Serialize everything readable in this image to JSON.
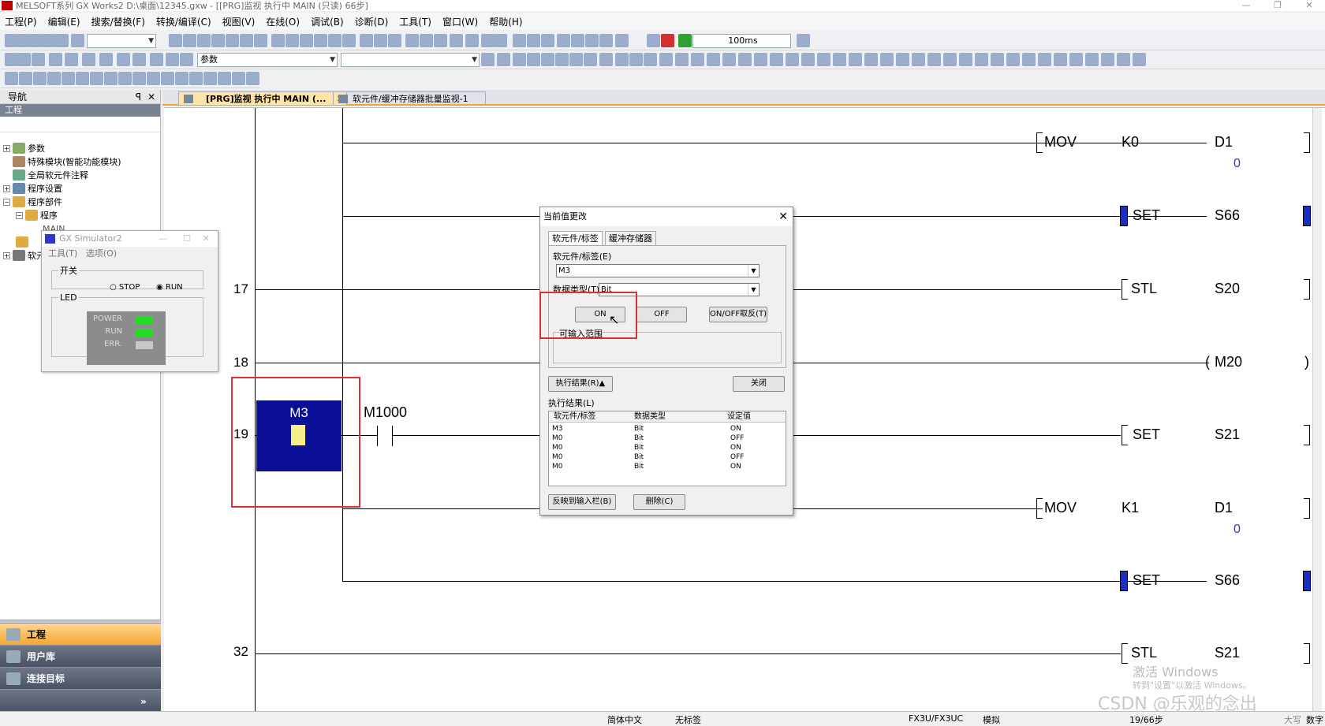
{
  "window": {
    "title": "MELSOFT系列 GX Works2 D:\\桌面\\12345.gxw - [[PRG]监视 执行中 MAIN (只读) 66步]"
  },
  "menu": [
    "工程(P)",
    "编辑(E)",
    "搜索/替换(F)",
    "转换/编译(C)",
    "视图(V)",
    "在线(O)",
    "调试(B)",
    "诊断(D)",
    "工具(T)",
    "窗口(W)",
    "帮助(H)"
  ],
  "toolbar": {
    "scan_time": "100ms",
    "param_combo": "参数"
  },
  "nav": {
    "title": "导航",
    "section": "工程",
    "tree": [
      "参数",
      "特殊模块(智能功能模块)",
      "全局软元件注释",
      "程序设置",
      "程序部件",
      "程序",
      "MAIN",
      "软元"
    ],
    "bottom": [
      "工程",
      "用户库",
      "连接目标"
    ]
  },
  "tabs": [
    "[PRG]监视 执行中 MAIN (...",
    "软元件/缓冲存储器批量监视-1 (..."
  ],
  "ladder": {
    "rungs": [
      "17",
      "18",
      "19",
      "32"
    ],
    "mov1": {
      "op": "MOV",
      "src": "K0",
      "dst": "D1",
      "val": "0"
    },
    "set1": {
      "op": "SET",
      "dev": "S66"
    },
    "stl1": {
      "op": "STL",
      "dev": "S20"
    },
    "out1": {
      "dev": "M20"
    },
    "contact_m3": "M3",
    "contact_m1000": "M1000",
    "set2": {
      "op": "SET",
      "dev": "S21"
    },
    "mov2": {
      "op": "MOV",
      "src": "K1",
      "dst": "D1",
      "val": "0"
    },
    "set3": {
      "op": "SET",
      "dev": "S66"
    },
    "stl2": {
      "op": "STL",
      "dev": "S21"
    }
  },
  "simulator": {
    "title": "GX Simulator2",
    "menu": [
      "工具(T)",
      "选项(O)"
    ],
    "switch_label": "开关",
    "stop": "STOP",
    "run": "RUN",
    "led_label": "LED",
    "leds": [
      {
        "name": "POWER",
        "color": "#22dd22"
      },
      {
        "name": "RUN",
        "color": "#22dd22"
      },
      {
        "name": "ERR.",
        "color": "#c8c8c8"
      }
    ]
  },
  "dialog": {
    "title": "当前值更改",
    "tab1": "软元件/标签",
    "tab2": "缓冲存储器",
    "device_label": "软元件/标签(E)",
    "device_value": "M3",
    "dtype_label": "数据类型(T)",
    "dtype_value": "Bit",
    "on": "ON",
    "off": "OFF",
    "toggle": "ON/OFF取反(T)",
    "range_label": "可输入范围",
    "exec_result_btn": "执行结果(R)▲",
    "close": "关闭",
    "result_label": "执行结果(L)",
    "columns": [
      "软元件/标签",
      "数据类型",
      "设定值"
    ],
    "rows": [
      [
        "M3",
        "Bit",
        "ON"
      ],
      [
        "M0",
        "Bit",
        "OFF"
      ],
      [
        "M0",
        "Bit",
        "ON"
      ],
      [
        "M0",
        "Bit",
        "OFF"
      ],
      [
        "M0",
        "Bit",
        "ON"
      ]
    ],
    "reflect": "反映到输入栏(B)",
    "delete": "删除(C)"
  },
  "status": {
    "lang": "简体中文",
    "label": "无标签",
    "cpu": "FX3U/FX3UC",
    "mode": "模拟",
    "steps": "19/66步",
    "caps": "大写",
    "num": "数字"
  },
  "watermark": {
    "line1": "激活 Windows",
    "line2": "转到\"设置\"以激活 Windows。",
    "csdn": "CSDN @乐观的念出"
  }
}
